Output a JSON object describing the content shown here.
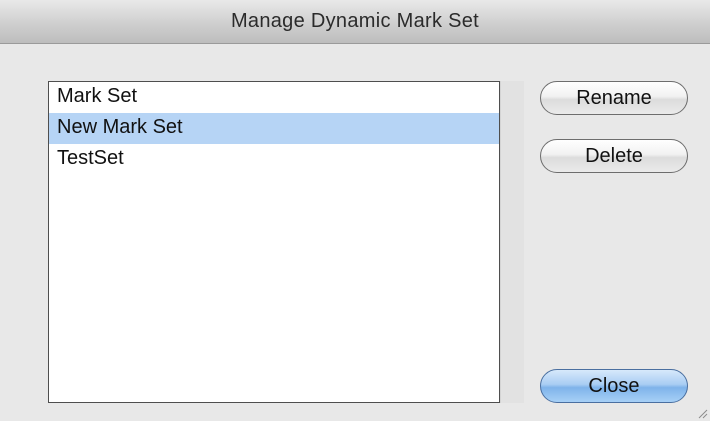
{
  "window": {
    "title": "Manage Dynamic Mark Set"
  },
  "mark_sets": [
    {
      "label": "Mark Set",
      "selected": false
    },
    {
      "label": "New Mark Set",
      "selected": true
    },
    {
      "label": "TestSet",
      "selected": false
    }
  ],
  "buttons": {
    "rename_label": "Rename",
    "delete_label": "Delete",
    "close_label": "Close"
  },
  "colors": {
    "selection": "#b6d4f5",
    "default_button": "#7fb3ea"
  }
}
